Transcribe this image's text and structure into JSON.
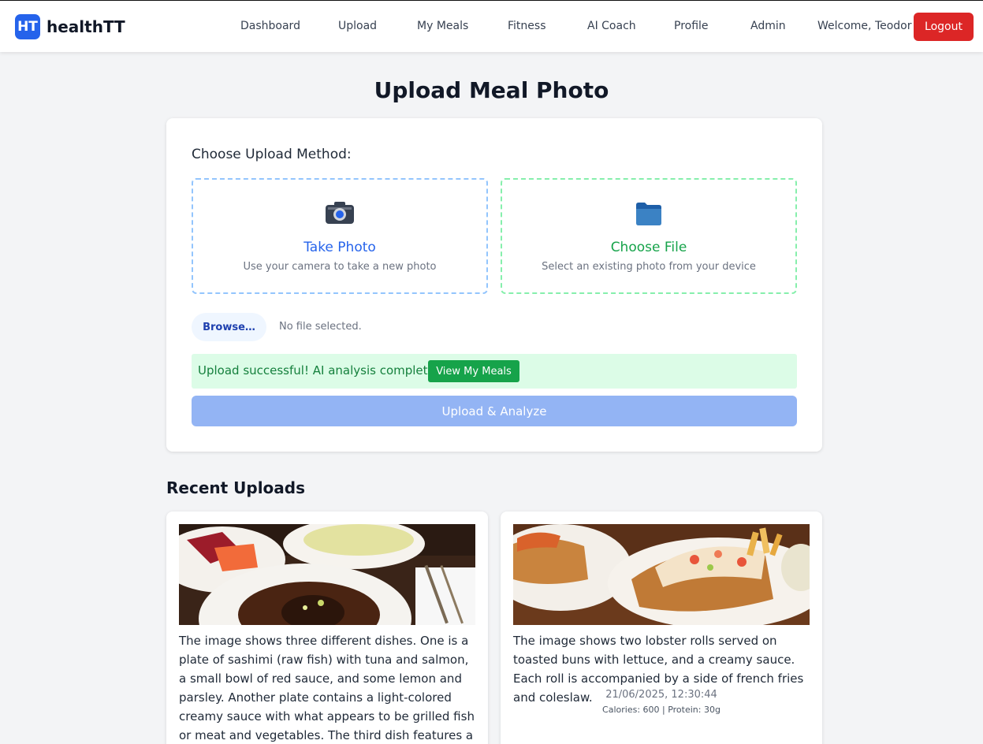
{
  "app": {
    "badge": "HT",
    "name": "healthTT"
  },
  "nav": {
    "links": [
      "Dashboard",
      "Upload",
      "My Meals",
      "Fitness",
      "AI Coach",
      "Profile",
      "Admin"
    ],
    "welcome": "Welcome, Teodor",
    "logout": "Logout"
  },
  "page": {
    "title": "Upload Meal Photo"
  },
  "upload": {
    "choose_label": "Choose Upload Method:",
    "take_photo": {
      "icon": "camera-icon",
      "title": "Take Photo",
      "subtitle": "Use your camera to take a new photo"
    },
    "choose_file": {
      "icon": "folder-icon",
      "title": "Choose File",
      "subtitle": "Select an existing photo from your device"
    },
    "browse_label": "Browse…",
    "file_status": "No file selected.",
    "success_message": "Upload successful! AI analysis complete.",
    "view_meals_label": "View My Meals",
    "analyze_label": "Upload & Analyze"
  },
  "recent": {
    "title": "Recent Uploads",
    "items": [
      {
        "image": "sashimi-and-plated-dishes-photo",
        "description": "The image shows three different dishes. One is a plate of sashimi (raw fish) with tuna and salmon, a small bowl of red sauce, and some lemon and parsley. Another plate contains a light-colored creamy sauce with what appears to be grilled fish or meat and vegetables. The third dish features a",
        "date": "",
        "stats": ""
      },
      {
        "image": "lobster-rolls-with-fries-photo",
        "description": "The image shows two lobster rolls served on toasted buns with lettuce, and a creamy sauce. Each roll is accompanied by a side of french fries and coleslaw.",
        "date": "21/06/2025, 12:30:44",
        "stats": "Calories: 600 | Protein: 30g"
      }
    ]
  },
  "colors": {
    "primary": "#2563eb",
    "danger": "#dc2626",
    "success": "#16a34a",
    "success_bg": "#dcfce7",
    "analyze_disabled": "#93b4f4"
  }
}
